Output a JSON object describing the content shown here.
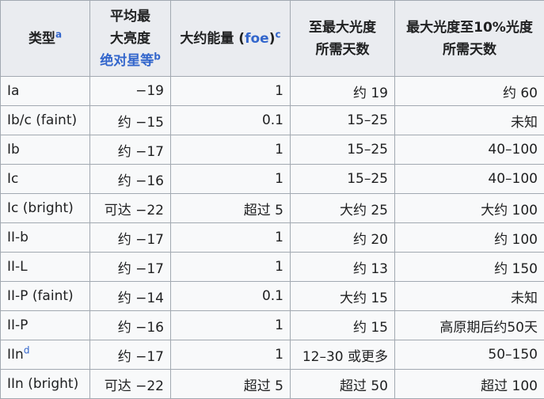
{
  "header": {
    "col1": "类型",
    "col1_note": "a",
    "col2_line1": "平均最",
    "col2_line2": "大亮度",
    "col2_line3": "绝对星等",
    "col2_note": "b",
    "col3_text": "大约能量 (",
    "col3_link": "foe",
    "col3_close": ")",
    "col3_note": "c",
    "col4_line1": "至最大光度",
    "col4_line2": "所需天数",
    "col5_line1": "最大光度至10%光度",
    "col5_line2": "所需天数"
  },
  "rows": [
    {
      "type": "Ia",
      "note": "",
      "mag": "−19",
      "energy": "1",
      "rise": "约 19",
      "decline": "约 60"
    },
    {
      "type": "Ib/c (faint)",
      "note": "",
      "mag": "约 −15",
      "energy": "0.1",
      "rise": "15–25",
      "decline": "未知"
    },
    {
      "type": "Ib",
      "note": "",
      "mag": "约 −17",
      "energy": "1",
      "rise": "15–25",
      "decline": "40–100"
    },
    {
      "type": "Ic",
      "note": "",
      "mag": "约 −16",
      "energy": "1",
      "rise": "15–25",
      "decline": "40–100"
    },
    {
      "type": "Ic (bright)",
      "note": "",
      "mag": "可达 −22",
      "energy": "超过 5",
      "rise": "大约 25",
      "decline": "大约 100"
    },
    {
      "type": "II-b",
      "note": "",
      "mag": "约 −17",
      "energy": "1",
      "rise": "约 20",
      "decline": "约 100"
    },
    {
      "type": "II-L",
      "note": "",
      "mag": "约 −17",
      "energy": "1",
      "rise": "约 13",
      "decline": "约 150"
    },
    {
      "type": "II-P (faint)",
      "note": "",
      "mag": "约 −14",
      "energy": "0.1",
      "rise": "大约 15",
      "decline": "未知"
    },
    {
      "type": "II-P",
      "note": "",
      "mag": "约 −16",
      "energy": "1",
      "rise": "约 15",
      "decline": "高原期后约50天"
    },
    {
      "type": "IIn",
      "note": "d",
      "mag": "约 −17",
      "energy": "1",
      "rise": "12–30 或更多",
      "decline": "50–150"
    },
    {
      "type": "IIn (bright)",
      "note": "",
      "mag": "可达 −22",
      "energy": "超过 5",
      "rise": "超过 50",
      "decline": "超过 100"
    }
  ],
  "colors": {
    "link": "#3366cc",
    "header_bg": "#eaecf0",
    "cell_bg": "#f8f9fa",
    "border": "#a2a9b1"
  }
}
